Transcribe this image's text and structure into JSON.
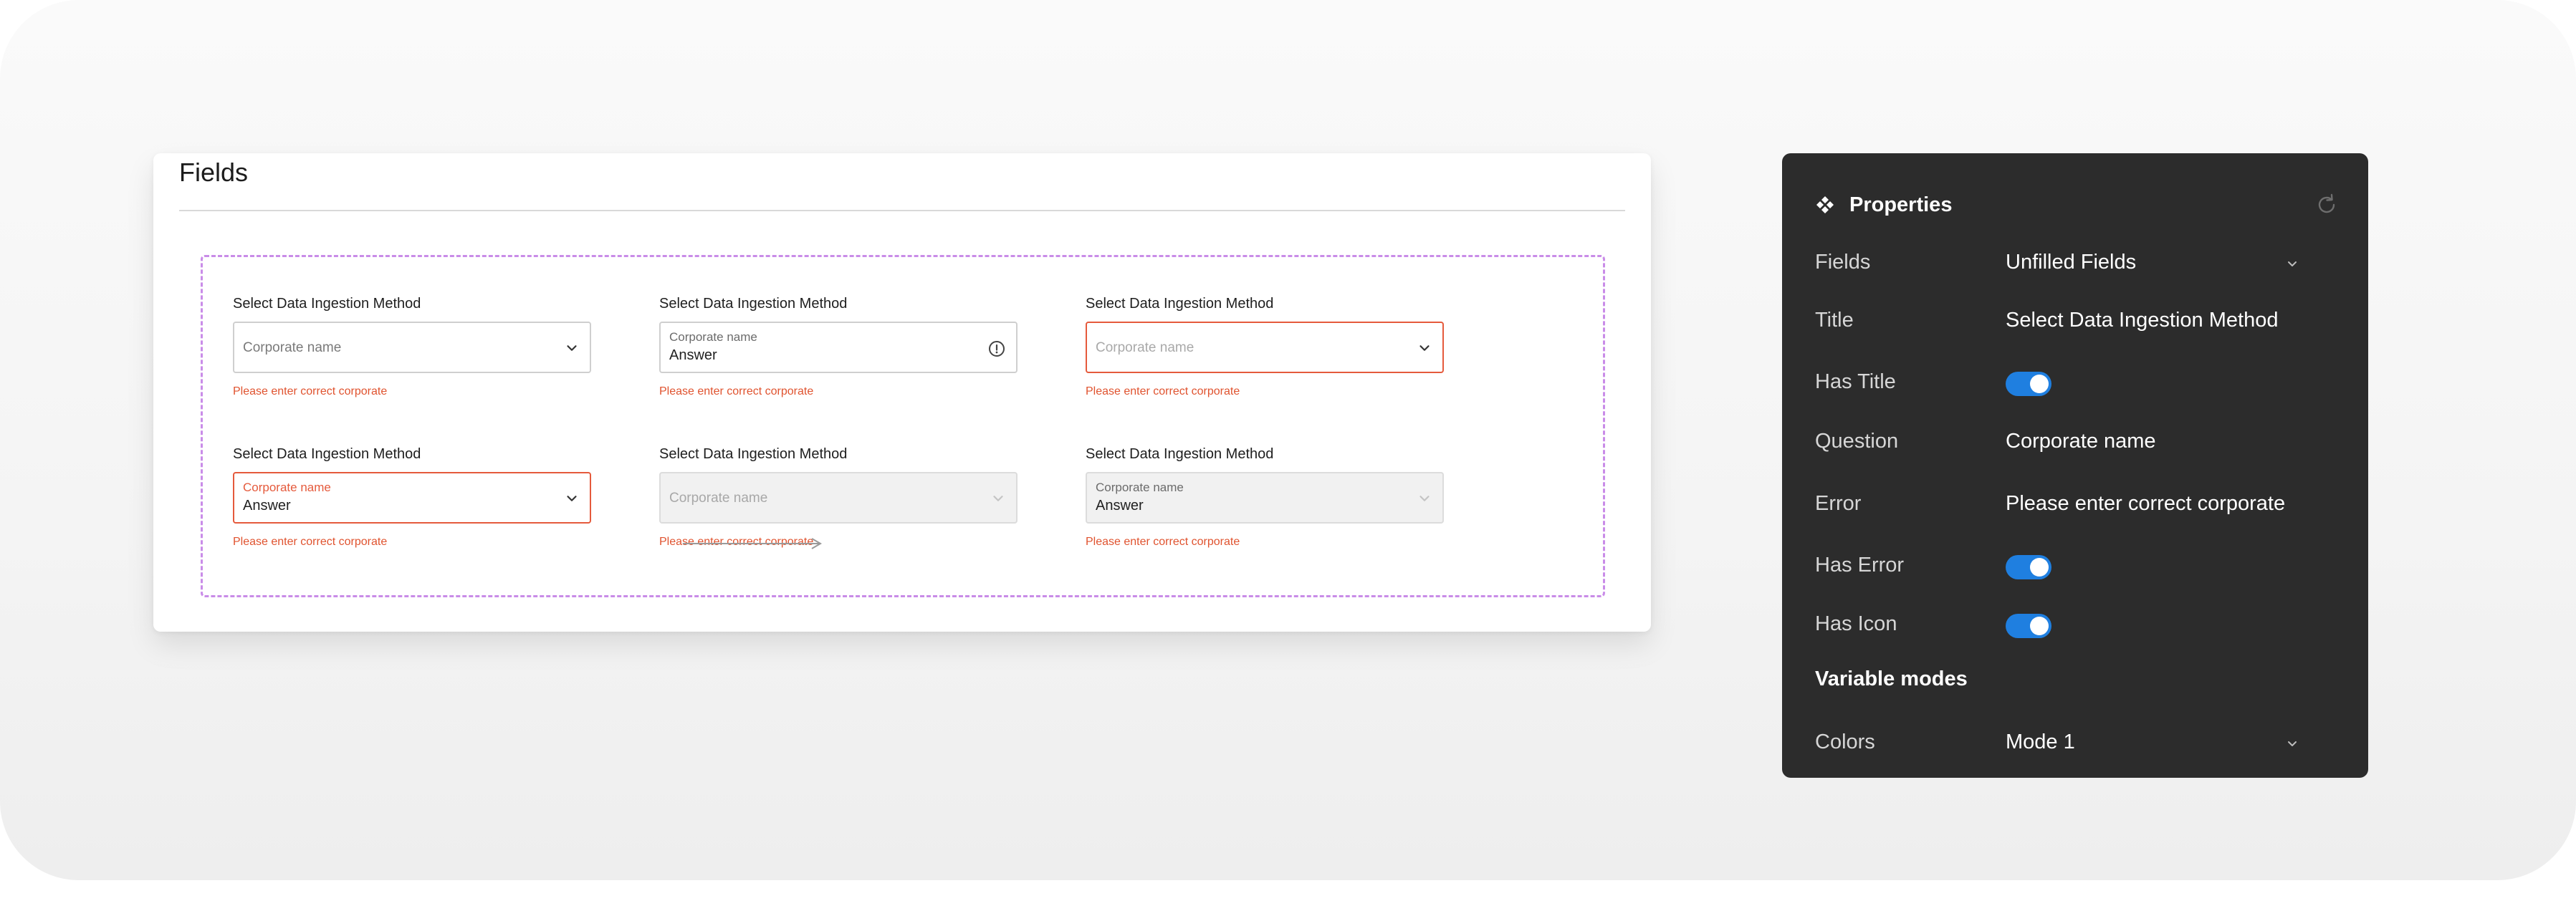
{
  "fields_card": {
    "title": "Fields",
    "variants": [
      {
        "label": "Select Data Ingestion Method",
        "placeholder": "Corporate name",
        "error": "Please enter correct corporate"
      },
      {
        "label": "Select Data Ingestion Method",
        "question": "Corporate name",
        "answer": "Answer",
        "error": "Please enter correct corporate"
      },
      {
        "label": "Select Data Ingestion Method",
        "placeholder": "Corporate name",
        "error": "Please enter correct corporate"
      },
      {
        "label": "Select Data Ingestion Method",
        "question": "Corporate name",
        "answer": "Answer",
        "error": "Please enter correct corporate"
      },
      {
        "label": "Select Data Ingestion Method",
        "placeholder": "Corporate name",
        "error": "Please enter correct corporate"
      },
      {
        "label": "Select Data Ingestion Method",
        "question": "Corporate name",
        "answer": "Answer",
        "error": "Please enter correct corporate"
      }
    ]
  },
  "properties": {
    "title": "Properties",
    "rows": {
      "fields": {
        "key": "Fields",
        "value": "Unfilled Fields"
      },
      "title": {
        "key": "Title",
        "value": "Select Data Ingestion Method"
      },
      "has_title": {
        "key": "Has Title"
      },
      "question": {
        "key": "Question",
        "value": "Corporate name"
      },
      "error": {
        "key": "Error",
        "value": "Please enter correct corporate"
      },
      "has_error": {
        "key": "Has Error"
      },
      "has_icon": {
        "key": "Has Icon"
      },
      "colors": {
        "key": "Colors",
        "value": "Mode 1"
      }
    },
    "section_variable_modes": "Variable modes"
  },
  "colors": {
    "panel_bg": "#2c2c2c",
    "toggle_on": "#1f7fe0",
    "error": "#e55a3c",
    "variant_frame": "#c98ce8"
  },
  "icons": {
    "component": "component-icon",
    "reset": "reset-icon",
    "chevron": "chevron-down-icon",
    "info": "info-icon"
  }
}
